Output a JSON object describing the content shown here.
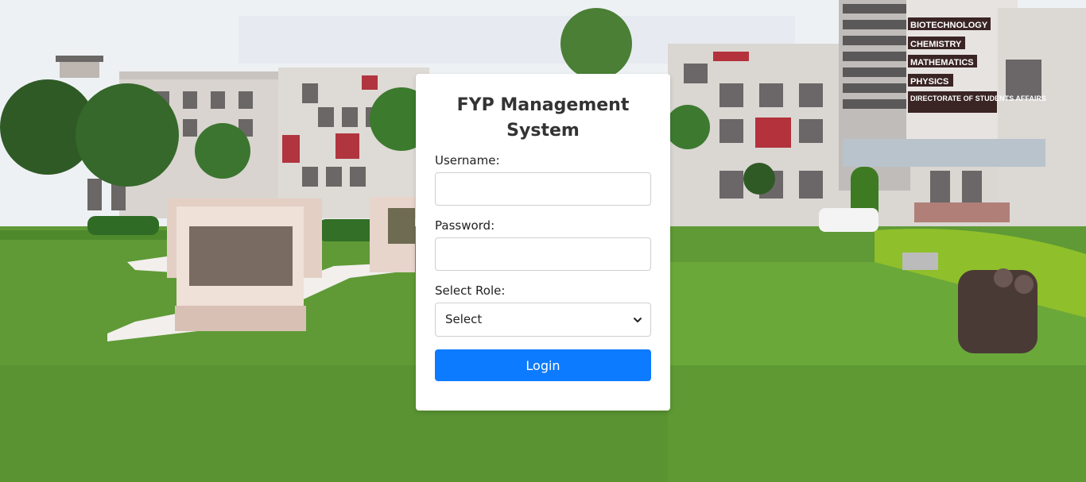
{
  "login": {
    "title": "FYP Management System",
    "username_label": "Username:",
    "username_value": "",
    "password_label": "Password:",
    "password_value": "",
    "role_label": "Select Role:",
    "role_selected": "Select",
    "button_label": "Login"
  },
  "background": {
    "building_signs": [
      "BIOTECHNOLOGY",
      "CHEMISTRY",
      "MATHEMATICS",
      "PHYSICS",
      "DIRECTORATE OF STUDENTS AFFAIRS"
    ]
  },
  "colors": {
    "button": "#0d7bff",
    "card": "#ffffff",
    "lawn": "#5f9a36"
  }
}
